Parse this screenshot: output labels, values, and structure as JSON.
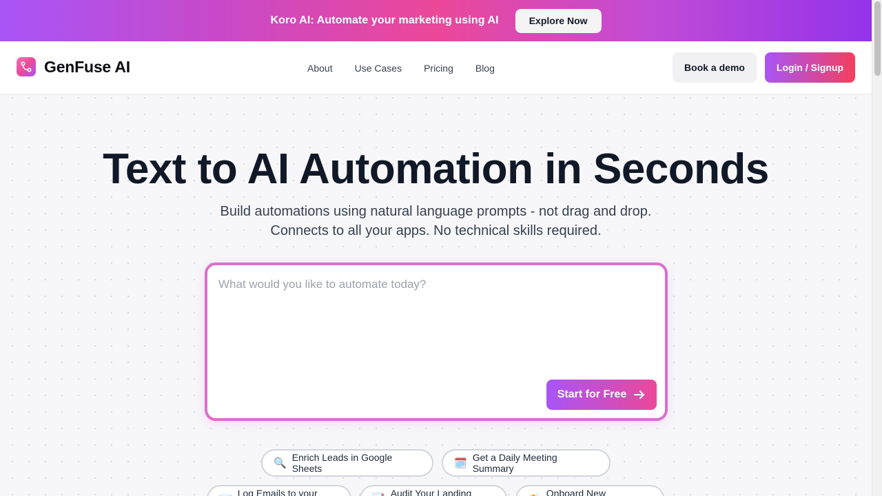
{
  "announcement": {
    "text": "Koro AI: Automate your marketing using AI",
    "button_label": "Explore Now"
  },
  "brand": {
    "name": "GenFuse AI",
    "logo_icon": "flow-connector-icon"
  },
  "nav": {
    "links": [
      "About",
      "Use Cases",
      "Pricing",
      "Blog"
    ],
    "demo_label": "Book a demo",
    "login_label": "Login / Signup"
  },
  "hero": {
    "title": "Text to AI Automation in Seconds",
    "subtitle_line1": "Build automations using natural language prompts - not drag and drop.",
    "subtitle_line2": "Connects to all your apps. No technical skills required."
  },
  "prompt": {
    "placeholder": "What would you like to automate today?",
    "value": "",
    "start_label": "Start for Free",
    "start_icon": "arrow-right-icon"
  },
  "chips": [
    {
      "emoji": "🔍",
      "label": "Enrich Leads in Google Sheets"
    },
    {
      "emoji": "🗓️",
      "label": "Get a Daily Meeting Summary"
    },
    {
      "emoji": "📧",
      "label": "Log Emails to your CRM"
    },
    {
      "emoji": "📝",
      "label": "Audit Your Landing Page"
    },
    {
      "emoji": "👏",
      "label": "Onboard New Customers"
    }
  ],
  "colors": {
    "accent_purple": "#a855f7",
    "accent_pink": "#ec4899",
    "accent_red": "#f43f5e",
    "prompt_border": "#da6fcd"
  }
}
